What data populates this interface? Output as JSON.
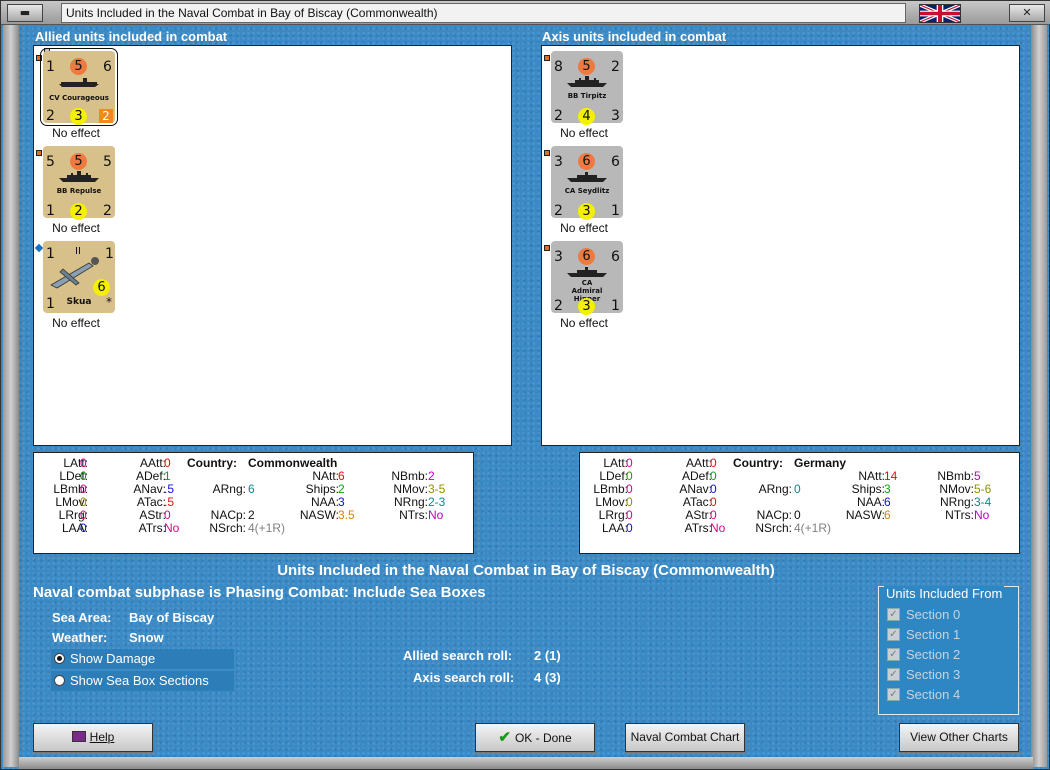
{
  "window": {
    "title": "Units Included in the Naval Combat in Bay of Biscay (Commonwealth)"
  },
  "allied": {
    "heading": "Allied units included in combat",
    "units": [
      {
        "name": "CV Courageous",
        "tl": "1",
        "tc": "5",
        "tr": "6",
        "bl": "2",
        "bc": "3",
        "br": "2",
        "effect": "No effect"
      },
      {
        "name": "BB Repulse",
        "tl": "5",
        "tc": "5",
        "tr": "5",
        "bl": "1",
        "bc": "2",
        "br": "2",
        "effect": "No effect"
      },
      {
        "name": "Skua",
        "tl": "1",
        "tc": "II",
        "tr": "1",
        "bl": "1",
        "bc": "6",
        "br": "*",
        "effect": "No effect"
      }
    ],
    "stats": {
      "country_label": "Country:",
      "country": "Commonwealth",
      "LAtt": "0",
      "LDef": "0",
      "LBmb": "0",
      "LMov": "0",
      "LRrg": "0",
      "LAA": "0",
      "AAtt": "0",
      "ADef": "1",
      "ANav": ".5",
      "ATac": ".5",
      "AStr": "0",
      "ATrs": "No",
      "ARng": "6",
      "NACp": "2",
      "NSrch": "4(+1R)",
      "NAtt": "6",
      "Ships": "2",
      "NAA": "3",
      "NASW": "3.5",
      "NBmb": "2",
      "NMov": "3-5",
      "NRng": "2-3",
      "NTrs": "No"
    }
  },
  "axis": {
    "heading": "Axis units included in combat",
    "units": [
      {
        "name": "BB Tirpitz",
        "tl": "8",
        "tc": "5",
        "tr": "2",
        "bl": "2",
        "bc": "4",
        "br": "3",
        "effect": "No effect"
      },
      {
        "name": "CA Seydlitz",
        "tl": "3",
        "tc": "6",
        "tr": "6",
        "bl": "2",
        "bc": "3",
        "br": "1",
        "effect": "No effect"
      },
      {
        "name": "CA Admiral Hipper",
        "tl": "3",
        "tc": "6",
        "tr": "6",
        "bl": "2",
        "bc": "3",
        "br": "1",
        "effect": "No effect"
      }
    ],
    "stats": {
      "country_label": "Country:",
      "country": "Germany",
      "LAtt": "0",
      "LDef": "0",
      "LBmb": "0",
      "LMov": "0",
      "LRrg": "0",
      "LAA": "0",
      "AAtt": "0",
      "ADef": "0",
      "ANav": "0",
      "ATac": "0",
      "AStr": "0",
      "ATrs": "No",
      "ARng": "0",
      "NACp": "0",
      "NSrch": "4(+1R)",
      "NAtt": "14",
      "Ships": "3",
      "NAA": "6",
      "NASW": "6",
      "NBmb": "5",
      "NMov": "5-6",
      "NRng": "3-4",
      "NTrs": "No"
    }
  },
  "colors": {
    "zero": "#e0008a",
    "red": "#e01010",
    "green": "#10a010",
    "blue": "#1010d0",
    "orange": "#e08000",
    "olive": "#909000",
    "teal": "#108a8a",
    "gray": "#808080"
  },
  "main_title": "Units Included in the Naval Combat in Bay of Biscay (Commonwealth)",
  "subphase": "Naval combat subphase is Phasing Combat: Include Sea Boxes",
  "sea_area": {
    "label": "Sea Area:",
    "value": "Bay of Biscay"
  },
  "weather": {
    "label": "Weather:",
    "value": "Snow"
  },
  "options": [
    {
      "label": "Show Damage",
      "selected": true
    },
    {
      "label": "Show Sea Box Sections",
      "selected": false
    }
  ],
  "allied_roll": {
    "label": "Allied search roll:",
    "value": "2 (1)"
  },
  "axis_roll": {
    "label": "Axis search roll:",
    "value": "4 (3)"
  },
  "sections": {
    "legend": "Units Included From",
    "items": [
      "Section 0",
      "Section 1",
      "Section 2",
      "Section 3",
      "Section 4"
    ]
  },
  "buttons": {
    "help": "Help",
    "ok": "OK - Done",
    "chart": "Naval Combat Chart",
    "other": "View Other Charts"
  }
}
